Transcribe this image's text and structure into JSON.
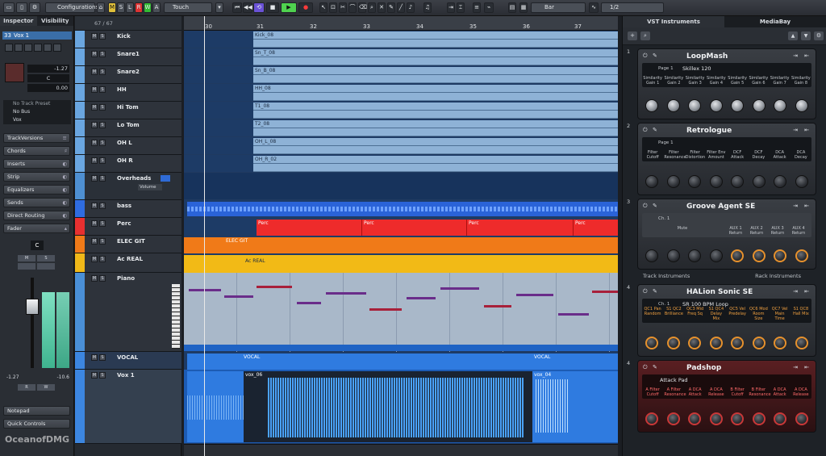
{
  "toolbar": {
    "configurations": "Configurations",
    "mode_letters": [
      "M",
      "S",
      "L",
      "R",
      "W",
      "A"
    ],
    "automation_mode": "Touch",
    "grid_type": "Bar",
    "quantize": "1/2"
  },
  "inspector": {
    "tabs": [
      "Inspector",
      "Visibility"
    ],
    "track_number": "33",
    "track_name": "Vox 1",
    "volume_readout": "-1.27",
    "pan_readout": "C",
    "delay_readout": "0.00",
    "preset": "No Track Preset",
    "bus": "No Bus",
    "output": "Vox",
    "sections": [
      "TrackVersions",
      "Chords",
      "Inserts",
      "Strip",
      "Equalizers",
      "Sends",
      "Direct Routing",
      "Fader"
    ],
    "fader_pan": "C",
    "meter_left": "-1.27",
    "meter_right": "-10.6",
    "notepad": "Notepad",
    "quick_controls": "Quick Controls"
  },
  "tracklist": {
    "count": "67 / 67",
    "tracks": [
      {
        "name": "Kick",
        "color": "#6aa6e0"
      },
      {
        "name": "Snare1",
        "color": "#6aa6e0"
      },
      {
        "name": "Snare2",
        "color": "#6aa6e0"
      },
      {
        "name": "HH",
        "color": "#6aa6e0"
      },
      {
        "name": "Hi Tom",
        "color": "#6aa6e0"
      },
      {
        "name": "Lo Tom",
        "color": "#6aa6e0"
      },
      {
        "name": "OH L",
        "color": "#6aa6e0"
      },
      {
        "name": "OH R",
        "color": "#6aa6e0"
      },
      {
        "name": "Overheads",
        "color": "#4e8fd1"
      },
      {
        "name": "bass",
        "color": "#2f6ce0"
      },
      {
        "name": "Perc",
        "color": "#e83030"
      },
      {
        "name": "ELEC GIT",
        "color": "#f07a18"
      },
      {
        "name": "Ac REAL",
        "color": "#f0b818"
      },
      {
        "name": "Piano",
        "color": "#4a8fd6"
      },
      {
        "name": "VOCAL",
        "color": "#3c86e0"
      },
      {
        "name": "Vox 1",
        "color": "#3c86e0"
      }
    ],
    "overheads_sub": "Volume"
  },
  "arrange": {
    "bars": [
      "30",
      "31",
      "32",
      "33",
      "34",
      "35",
      "36",
      "37"
    ],
    "events": {
      "kick": "Kick_08",
      "snare1": "Sn_T_08",
      "snare2": "Sn_B_08",
      "hh": "HH_08",
      "hitom": "T1_08",
      "lotom": "T2_08",
      "ohl": "OH_L_08",
      "ohr": "OH_R_02",
      "perc": [
        "Perc",
        "Perc",
        "Perc",
        "Perc"
      ],
      "elecgit": "ELEC GIT",
      "acreal": "Ac REAL",
      "vocal": [
        "VOCAL",
        "VOCAL"
      ],
      "vox": [
        "vox_06",
        "vox_04"
      ]
    }
  },
  "vsti": {
    "tabs": [
      "VST Instruments",
      "MediaBay"
    ],
    "instruments": [
      {
        "slot": "1",
        "name": "LoopMash",
        "page": "Page 1",
        "preset": "Skillex 120",
        "controls": [
          "Similarity Gain 1",
          "Similarity Gain 2",
          "Similarity Gain 3",
          "Similarity Gain 4",
          "Similarity Gain 5",
          "Similarity Gain 6",
          "Similarity Gain 7",
          "Similarity Gain 8"
        ]
      },
      {
        "slot": "2",
        "name": "Retrologue",
        "page": "Page 1",
        "preset": "",
        "controls": [
          "Filter Cutoff",
          "Filter Resonance",
          "Filter Distortion",
          "Filter Env Amount",
          "DCF Attack",
          "DCF Decay",
          "DCA Attack",
          "DCA Decay"
        ]
      },
      {
        "slot": "3",
        "name": "Groove Agent SE",
        "page": "Ch. 1",
        "preset": "",
        "controls": [
          "Mute",
          "AUX 1 Return",
          "AUX 2 Return",
          "AUX 3 Return",
          "AUX 4 Return"
        ]
      },
      {
        "slot": "4",
        "name": "HALion Sonic SE",
        "page": "Ch. 1",
        "preset": "SR 100 BPM Loop",
        "controls": [
          "QC1 Pan Random",
          "S1 QC2 Brilliance",
          "QC3 Mid Freq Sq",
          "S1 QC4 Delay Mix",
          "QC5 Vel Predelay",
          "QC6 Mod Room Size",
          "QC7 Vel Main Time",
          "S1 QC8 Hall Mix"
        ]
      },
      {
        "slot": "4",
        "name": "Padshop",
        "page": "",
        "preset": "Attack Pad",
        "controls": [
          "A Filter Cutoff",
          "A Filter Resonance",
          "A DCA Attack",
          "A DCA Release",
          "B Filter Cutoff",
          "B Filter Resonance",
          "A DCA Attack",
          "A DCA Release"
        ]
      }
    ],
    "track_instruments": "Track Instruments",
    "rack_instruments": "Rack Instruments"
  },
  "watermark": "OceanofDMG"
}
